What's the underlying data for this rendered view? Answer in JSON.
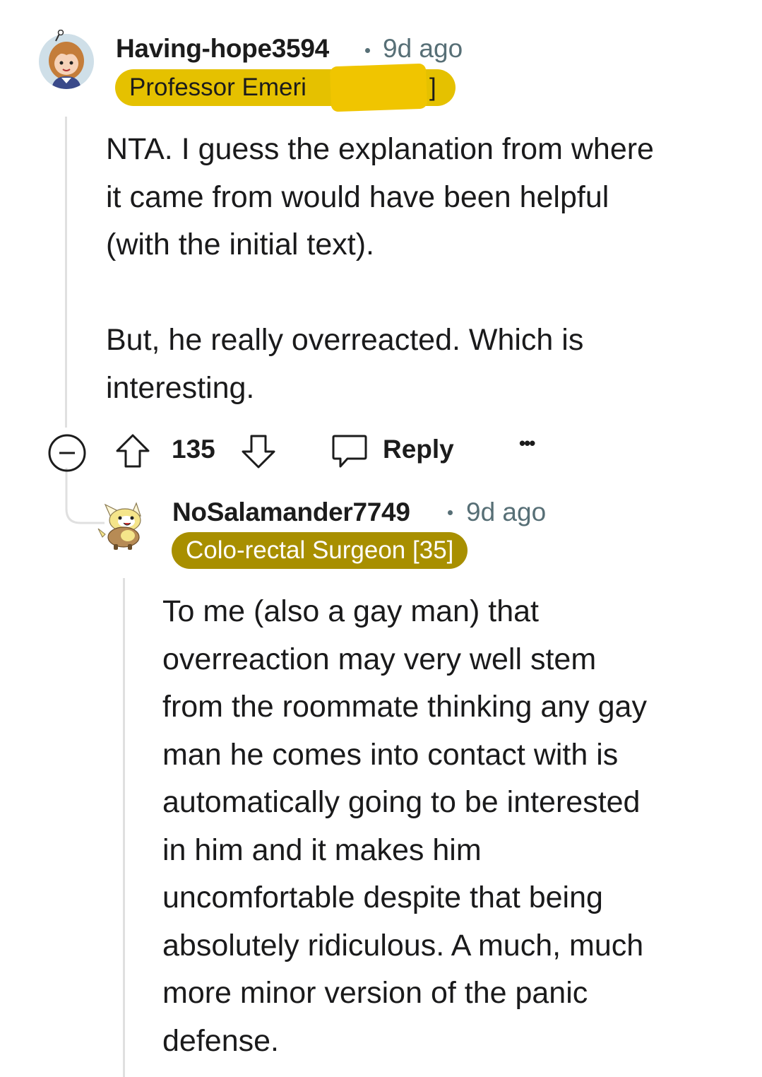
{
  "comment1": {
    "username": "Having-hope3594",
    "time": "9d ago",
    "flair": "Professor Emeri",
    "flair_tail": "]",
    "flair_bg": "#e5c100",
    "body": "NTA. I guess the explanation from where\nit came from would have been helpful\n(with the initial text).\n\nBut, he really overreacted. Which is\ninteresting.",
    "avatar_icon": "avatar-girl-icon"
  },
  "actions": {
    "collapse_icon": "minus-circle-icon",
    "upvote_icon": "arrow-up-icon",
    "score": "135",
    "downvote_icon": "arrow-down-icon",
    "reply_icon": "speech-bubble-icon",
    "reply_label": "Reply",
    "more_label": "•••"
  },
  "comment2": {
    "username": "NoSalamander7749",
    "time": "9d ago",
    "flair": "Colo-rectal Surgeon [35]",
    "flair_bg": "#a88f00",
    "body": "To me (also a gay man) that\noverreaction may very well stem\nfrom the roommate thinking any gay\nman he comes into contact with is\nautomatically going to be interested\nin him and it makes him\nuncomfortable despite that being\nabsolutely ridiculous. A much, much\nmore minor version of the panic\ndefense.",
    "avatar_icon": "avatar-yamper-icon"
  }
}
